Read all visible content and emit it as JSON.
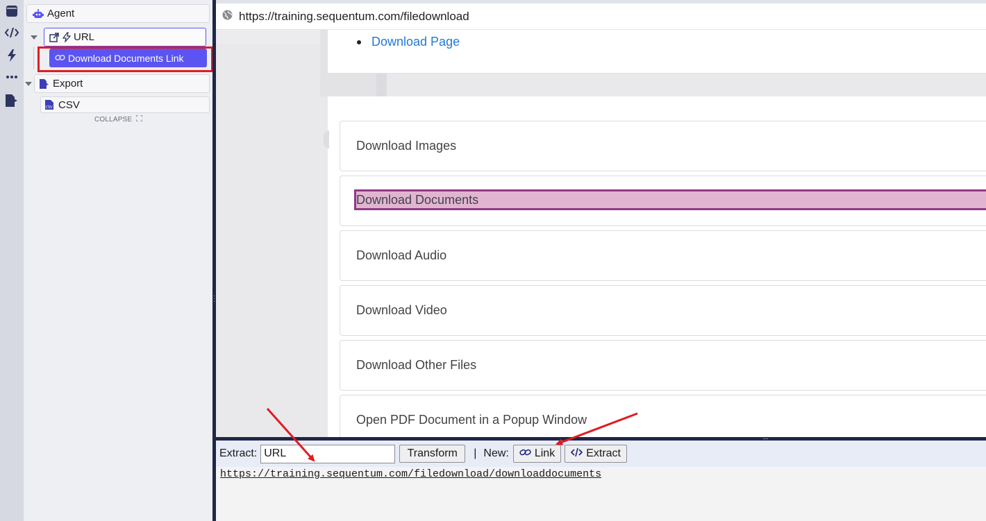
{
  "rail": {
    "icons": [
      "window-icon",
      "code-icon",
      "bolt-icon",
      "more-icon",
      "export-icon"
    ]
  },
  "tree": {
    "agent_label": "Agent",
    "url_label": "URL",
    "download_link_label": "Download Documents Link",
    "export_label": "Export",
    "csv_label": "CSV",
    "collapse_label": "COLLAPSE"
  },
  "browser": {
    "address": "https://training.sequentum.com/filedownload",
    "top_link": "Download Page",
    "items": [
      "Download Images",
      "Download Documents",
      "Download Audio",
      "Download Video",
      "Download Other Files",
      "Open PDF Document in a Popup Window"
    ],
    "highlighted_index": 1
  },
  "bottom": {
    "extract_label": "Extract:",
    "extract_value": "URL",
    "transform_label": "Transform",
    "separator": "|",
    "new_label": "New:",
    "link_button": "Link",
    "extract_button": "Extract",
    "result_url": "https://training.sequentum.com/filedownload/downloaddocuments"
  },
  "colors": {
    "accent": "#5b54f2",
    "highlight_fill": "#e1b5d2",
    "highlight_border": "#8f3a86",
    "annotation_red": "#e01b23",
    "link_blue": "#1e7ad6"
  }
}
